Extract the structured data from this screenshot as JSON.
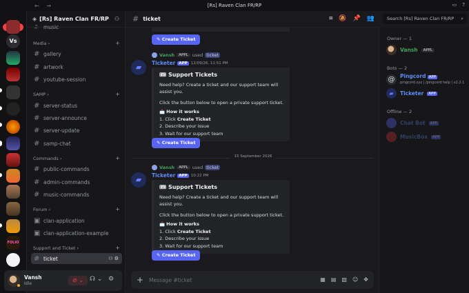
{
  "window": {
    "nav": "← →",
    "title": "[Rs] Raven Clan FR/RP"
  },
  "servers": {
    "new_badge": "NEW",
    "vs_label": "Vs",
    "folio_label": "FOLIO"
  },
  "sidebar": {
    "server_name": "[Rs] Raven Clan FR/RP",
    "partial_item": "music",
    "categories": [
      {
        "label": "Media",
        "channels": [
          "gallery",
          "artwork",
          "youtube-session"
        ]
      },
      {
        "label": "SAMP",
        "channels": [
          "server-status",
          "server-announce",
          "server-update",
          "samp-chat"
        ]
      },
      {
        "label": "Commands",
        "channels": [
          "public-commands",
          "admin-commands",
          "music-commands"
        ]
      },
      {
        "label": "Forum",
        "channels": [
          "clan-application",
          "clan-application-example"
        ]
      },
      {
        "label": "Support and Ticket",
        "channels": [
          "ticket"
        ]
      }
    ]
  },
  "user": {
    "name": "Vansh",
    "status": "Idle"
  },
  "channel": {
    "name": "ticket"
  },
  "search": {
    "placeholder": "Search [Rs] Raven Clan FR/RP"
  },
  "messages": {
    "top_button": "Create Ticket",
    "msg1": {
      "reply_user": "Vansh",
      "reply_tag": "APPL",
      "reply_used": "used",
      "reply_cmd": "ticket",
      "bot": "Ticketer",
      "app": "APP",
      "time": "12/09/26, 11:51 PM",
      "embed_title": "Support Tickets",
      "line1": "Need help? Create a ticket and our support team will assist you.",
      "line2": "Click the button below to open a private support ticket.",
      "how": "How it works",
      "step1_pre": "1. Click",
      "step1_bold": "Create Ticket",
      "step2": "2. Describe your issue",
      "step3": "3. Wait for our support team",
      "button": "Create Ticket"
    },
    "date_divider": "15 September 2026",
    "msg2": {
      "reply_user": "Vansh",
      "reply_tag": "APPL",
      "reply_used": "used",
      "reply_cmd": "ticket",
      "bot": "Ticketer",
      "app": "APP",
      "time": "10:22 PM",
      "embed_title": "Support Tickets",
      "line1": "Need help? Create a ticket and our support team will assist you.",
      "line2": "Click the button below to open a private support ticket.",
      "how": "How it works",
      "step1_pre": "1. Click",
      "step1_bold": "Create Ticket",
      "step2": "2. Describe your issue",
      "step3": "3. Wait for our support team",
      "button": "Create Ticket"
    }
  },
  "composer": {
    "placeholder": "Message #ticket"
  },
  "members": {
    "owner_head": "Owner — 1",
    "owner": {
      "name": "Vansh",
      "tag": "APPL"
    },
    "bots_head": "Bots — 2",
    "bot1": {
      "name": "Pingcord",
      "app": "APP",
      "sub": "pingcord.xyz | /pingcord help | v2.2.1"
    },
    "bot2": {
      "name": "Ticketer",
      "app": "APP"
    },
    "offline_head": "Offline — 2",
    "off1": {
      "name": "Chat Bot",
      "app": "APP"
    },
    "off2": {
      "name": "MusicBox",
      "app": "APP"
    }
  }
}
